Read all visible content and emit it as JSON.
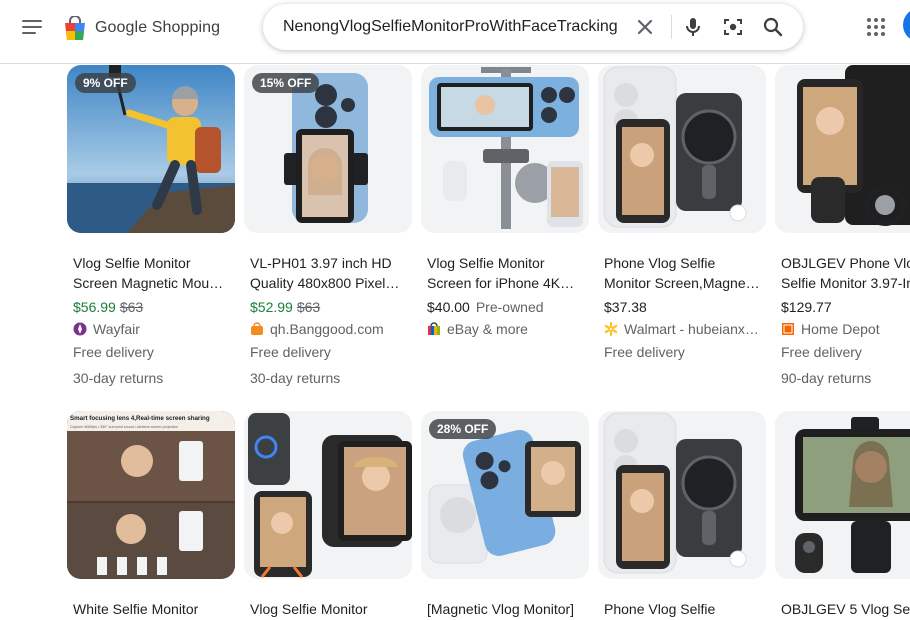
{
  "header": {
    "logo_text": "Google Shopping",
    "search_value": "NenongVlogSelfieMonitorProWithFaceTracking"
  },
  "icons": {
    "menu": "hamburger-menu-icon",
    "clear": "close-icon",
    "voice": "microphone-icon",
    "lens": "camera-lens-icon",
    "search": "search-icon",
    "apps": "apps-grid-icon"
  },
  "colors": {
    "sale_price": "#188038",
    "badge_bg": "#3c4043",
    "accent": "#1a73e8"
  },
  "products": [
    {
      "title_line1": "Vlog Selfie Monitor",
      "title_line2": "Screen Magnetic Mou…",
      "badge": "9% OFF",
      "price": "$56.99",
      "old_price": "$63",
      "condition": "",
      "store": "Wayfair",
      "delivery": "Free delivery",
      "returns": "30-day returns"
    },
    {
      "title_line1": "VL-PH01 3.97 inch HD",
      "title_line2": "Quality 480x800 Pixel…",
      "badge": "15% OFF",
      "price": "$52.99",
      "old_price": "$63",
      "condition": "",
      "store": "qh.Banggood.com",
      "delivery": "Free delivery",
      "returns": "30-day returns"
    },
    {
      "title_line1": "Vlog Selfie Monitor",
      "title_line2": "Screen for iPhone 4K…",
      "badge": "",
      "price": "$40.00",
      "old_price": "",
      "condition": "Pre-owned",
      "store": "eBay & more",
      "delivery": "",
      "returns": ""
    },
    {
      "title_line1": "Phone Vlog Selfie",
      "title_line2": "Monitor Screen,Magne…",
      "badge": "",
      "price": "$37.38",
      "old_price": "",
      "condition": "",
      "store": "Walmart - hubeianx…",
      "delivery": "Free delivery",
      "returns": ""
    },
    {
      "title_line1": "OBJLGEV Phone Vlo",
      "title_line2": "Selfie Monitor 3.97-In",
      "badge": "",
      "price": "$129.77",
      "old_price": "",
      "condition": "",
      "store": "Home Depot",
      "delivery": "Free delivery",
      "returns": "90-day returns"
    },
    {
      "title_line1": "White Selfie Monitor",
      "badge": "",
      "banner_line1": "Smart focusing lens 4,Real-time screen sharing",
      "banner_line2": "Capture 4K60fps  •  360° surround sound  •  wireless screen projection"
    },
    {
      "title_line1": "Vlog Selfie Monitor",
      "badge": ""
    },
    {
      "title_line1": "[Magnetic Vlog Monitor]",
      "badge": "28% OFF"
    },
    {
      "title_line1": "Phone Vlog Selfie",
      "badge": ""
    },
    {
      "title_line1": "OBJLGEV 5 Vlog Sel",
      "badge": ""
    }
  ]
}
